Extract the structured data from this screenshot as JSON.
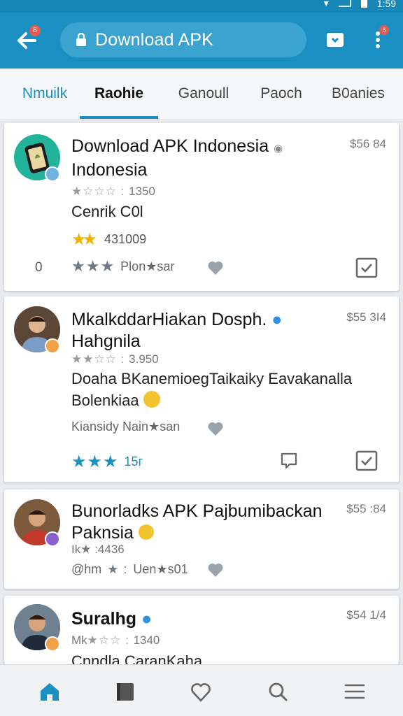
{
  "status": {
    "time": "1:59"
  },
  "appbar": {
    "back_badge": "8",
    "url": "Download APK",
    "more_badge": "6"
  },
  "tabs": [
    "Nmuilk",
    "Raohie",
    "Ganoull",
    "Paoch",
    "B0anies"
  ],
  "selected_tab": 1,
  "cards": [
    {
      "title_line1": "Download APK Indonesia",
      "title_line2": "Indonesia",
      "price": "$56 84",
      "rating": "1350",
      "subtitle": "Cenrik C0l",
      "count": "431009",
      "left_value": "0",
      "meta_label": "Plon★sar",
      "avatar": "app-icon"
    },
    {
      "title_line1": "MkalkddarHiakan Dosph.",
      "title_line2": "Hahgnila",
      "price": "$55 3I4",
      "rating": "3.950",
      "desc_line1": "Doaha BKanemioegTaikaiky Eavakanalla",
      "desc_line2": "Bolenkiaa",
      "meta_label": "Kiansidy  Nain★san",
      "blue_count": "15г",
      "avatar": "person-photo"
    },
    {
      "title_line1": "Bunorladks APK Pajbumibackan",
      "title_line2": "Paknsia",
      "price": "$55 :84",
      "rating_prefix": "Ik★",
      "rating": "4436",
      "meta_prefix": "@hm",
      "meta_label": "Uen★s01",
      "avatar": "person-photo"
    },
    {
      "title_line1": "Suralhg",
      "price": "$54 1/4",
      "rating_prefix": "Mk",
      "rating": "1340",
      "desc_line1": "Cnndla CaranKaha",
      "avatar": "person-photo"
    }
  ],
  "bottom_nav": [
    "home-icon",
    "book-icon",
    "heart-icon",
    "search-icon",
    "menu-icon"
  ],
  "colors": {
    "accent": "#1a8fc1",
    "appbar": "#1a8fc1",
    "badge": "#e85a4f",
    "star_gold": "#f0b400"
  }
}
